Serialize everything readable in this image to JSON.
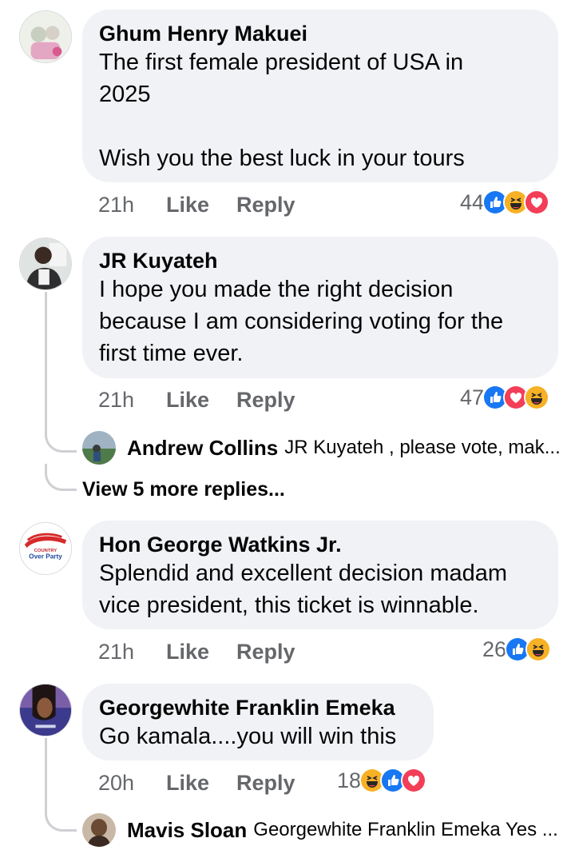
{
  "comments": [
    {
      "author": "Ghum Henry Makuei",
      "text": "The first female president of USA in\n2025\n\nWish you the best luck in your tours",
      "time": "21h",
      "like": "Like",
      "reply": "Reply",
      "reaction_count": "44",
      "reactions": [
        "like-icon",
        "haha-icon",
        "love-icon"
      ]
    },
    {
      "author": "JR Kuyateh",
      "text": "I hope you made the right decision\nbecause I am considering voting for the\nfirst time ever.",
      "time": "21h",
      "like": "Like",
      "reply": "Reply",
      "reaction_count": "47",
      "reactions": [
        "like-icon",
        "love-icon",
        "haha-icon"
      ],
      "reply_preview": {
        "author": "Andrew Collins",
        "text": "JR Kuyateh , please vote, mak..."
      },
      "view_more": "View 5 more replies..."
    },
    {
      "author": "Hon George Watkins Jr.",
      "text": "Splendid and excellent decision madam\nvice president, this ticket is winnable.",
      "time": "21h",
      "like": "Like",
      "reply": "Reply",
      "reaction_count": "26",
      "reactions": [
        "like-icon",
        "haha-icon"
      ],
      "avatar_text": {
        "top": "COUNTRY",
        "bottom": "Over Party"
      }
    },
    {
      "author": "Georgewhite Franklin Emeka",
      "text": "Go kamala....you will win this",
      "time": "20h",
      "like": "Like",
      "reply": "Reply",
      "reaction_count": "18",
      "reactions": [
        "haha-icon",
        "like-icon",
        "love-icon"
      ],
      "reply_preview": {
        "author": "Mavis Sloan",
        "text": "Georgewhite Franklin Emeka Yes ..."
      }
    }
  ],
  "colors": {
    "like": "#1877f2",
    "love": "#f33e58",
    "haha": "#f7b125",
    "bubble": "#f0f2f5",
    "meta": "#65676b"
  }
}
